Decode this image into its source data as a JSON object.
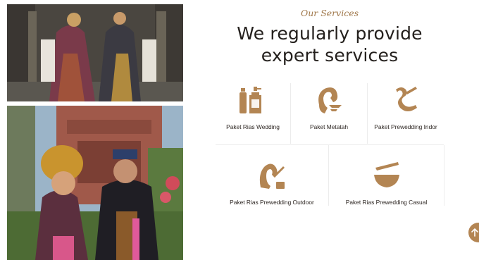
{
  "section": {
    "eyebrow": "Our Services",
    "headline_line1": "We regularly provide",
    "headline_line2": "expert services"
  },
  "services": [
    {
      "label": "Paket Rias Wedding",
      "icon": "cosmetics-bottle-icon"
    },
    {
      "label": "Paket Metatah",
      "icon": "hair-beauty-icon"
    },
    {
      "label": "Paket Prewedding Indor",
      "icon": "hair-curl-icon"
    },
    {
      "label": "Paket Rias Prewedding Outdoor",
      "icon": "hair-brush-woman-icon"
    },
    {
      "label": "Paket Rias Prewedding Casual",
      "icon": "mortar-pestle-icon"
    }
  ],
  "colors": {
    "accent": "#a0784b",
    "icon": "#b38553",
    "text": "#24201d"
  }
}
